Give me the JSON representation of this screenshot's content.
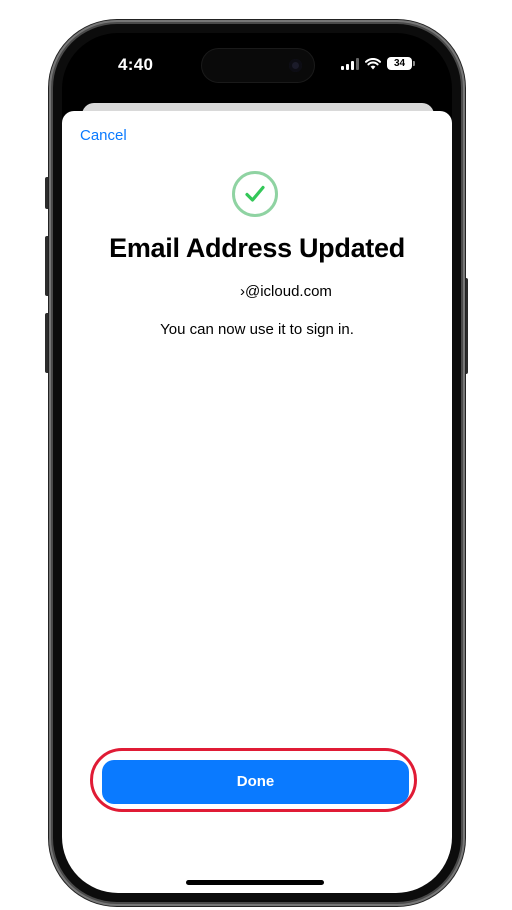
{
  "status_bar": {
    "time": "4:40",
    "battery": "34",
    "signal_icon": "cellular-signal-icon",
    "wifi_icon": "wifi-icon"
  },
  "nav": {
    "cancel_label": "Cancel"
  },
  "content": {
    "icon": "checkmark-circle-icon",
    "title": "Email Address Updated",
    "email": "›@icloud.com",
    "message": "You can now use it to sign in."
  },
  "actions": {
    "done_label": "Done"
  },
  "colors": {
    "accent": "#0a7aff",
    "success": "#34c759",
    "highlight_ring": "#e01b35"
  }
}
